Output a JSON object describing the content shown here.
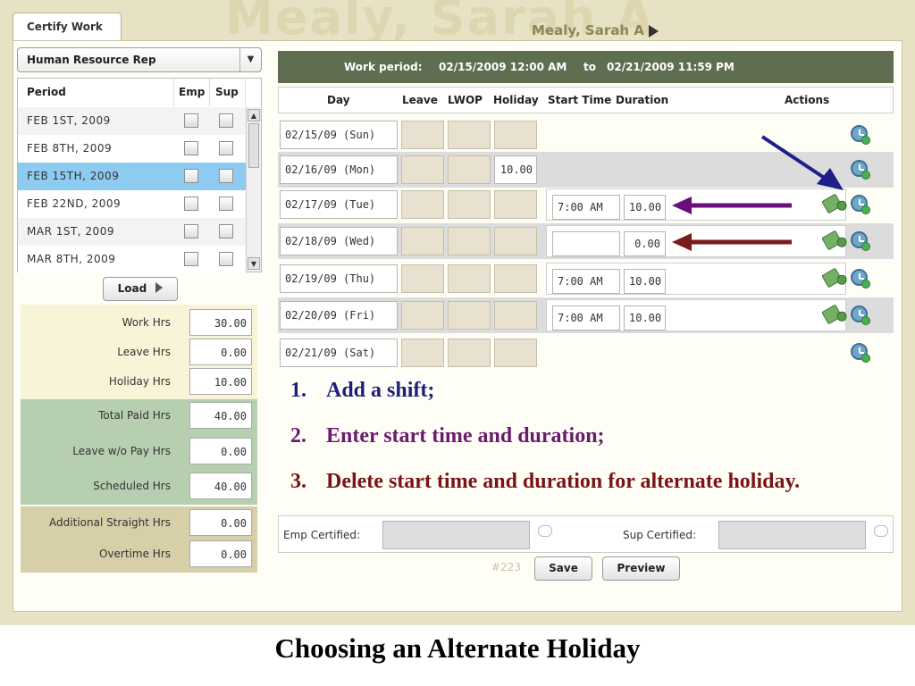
{
  "tab_label": "Certify Work",
  "watermark": "Mealy, Sarah A",
  "employee_name": "Mealy, Sarah A",
  "role_select": {
    "value": "Human Resource Rep"
  },
  "period_table": {
    "headers": [
      "Period",
      "Emp",
      "Sup"
    ],
    "rows": [
      {
        "label": "FEB 1ST, 2009",
        "selected": false
      },
      {
        "label": "FEB 8TH, 2009",
        "selected": false
      },
      {
        "label": "FEB 15TH, 2009",
        "selected": true
      },
      {
        "label": "FEB 22ND, 2009",
        "selected": false
      },
      {
        "label": "MAR 1ST, 2009",
        "selected": false
      },
      {
        "label": "MAR 8TH, 2009",
        "selected": false
      }
    ]
  },
  "load_button": "Load",
  "totals": [
    {
      "label": "Work Hrs",
      "value": "30.00"
    },
    {
      "label": "Leave Hrs",
      "value": "0.00"
    },
    {
      "label": "Holiday Hrs",
      "value": "10.00"
    },
    {
      "label": "Total Paid Hrs",
      "value": "40.00"
    },
    {
      "label": "Leave w/o Pay Hrs",
      "value": "0.00"
    },
    {
      "label": "Scheduled Hrs",
      "value": "40.00"
    },
    {
      "label": "Additional Straight Hrs",
      "value": "0.00"
    },
    {
      "label": "Overtime Hrs",
      "value": "0.00"
    }
  ],
  "work_period": {
    "label": "Work period:",
    "start": "02/15/2009 12:00 AM",
    "to": "to",
    "end": "02/21/2009 11:59 PM"
  },
  "columns": {
    "day": "Day",
    "leave": "Leave",
    "lwop": "LWOP",
    "holiday": "Holiday",
    "start_time": "Start Time",
    "duration": "Duration",
    "actions": "Actions"
  },
  "days": [
    {
      "day": "02/15/09 (Sun)",
      "holiday": "",
      "start": null,
      "duration": null,
      "money": false
    },
    {
      "day": "02/16/09 (Mon)",
      "holiday": "10.00",
      "start": null,
      "duration": null,
      "money": false
    },
    {
      "day": "02/17/09 (Tue)",
      "holiday": "",
      "start": "7:00 AM",
      "duration": "10.00",
      "money": true
    },
    {
      "day": "02/18/09 (Wed)",
      "holiday": "",
      "start": "",
      "duration": "0.00",
      "money": true
    },
    {
      "day": "02/19/09 (Thu)",
      "holiday": "",
      "start": "7:00 AM",
      "duration": "10.00",
      "money": true
    },
    {
      "day": "02/20/09 (Fri)",
      "holiday": "",
      "start": "7:00 AM",
      "duration": "10.00",
      "money": true
    },
    {
      "day": "02/21/09 (Sat)",
      "holiday": "",
      "start": null,
      "duration": null,
      "money": false
    }
  ],
  "instructions": [
    {
      "num": "1.",
      "text": "Add a shift;",
      "color": "#1d1f7a"
    },
    {
      "num": "2.",
      "text": "Enter start time and duration;",
      "color": "#6a1b6e"
    },
    {
      "num": "3.",
      "text": "Delete start time and duration for alternate holiday.",
      "color": "#7a1414"
    }
  ],
  "certify": {
    "emp_label": "Emp Certified:",
    "sup_label": "Sup Certified:"
  },
  "record_id": "#223",
  "save_button": "Save",
  "preview_button": "Preview",
  "caption": "Choosing an Alternate Holiday",
  "colors": {
    "arrow_blue": "#1d1f8a",
    "arrow_purple": "#6a0f7a",
    "arrow_darkred": "#7a1a1a",
    "header_green": "#5f6e50"
  }
}
